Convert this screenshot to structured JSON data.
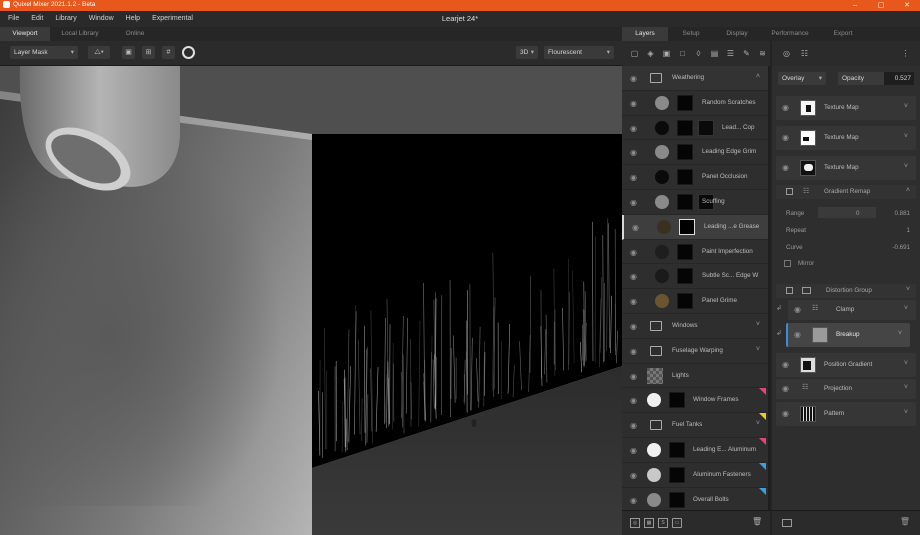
{
  "app": {
    "title": "Quixel Mixer 2021.1.2 - Beta",
    "document": "Learjet 24*"
  },
  "window_controls": {
    "minimize": "–",
    "maximize": "▢",
    "close": "✕"
  },
  "menu": [
    "File",
    "Edit",
    "Library",
    "Window",
    "Help",
    "Experimental"
  ],
  "viewport_tabs": [
    "Viewport",
    "Local Library",
    "Online"
  ],
  "viewport_toolbar": {
    "view_mode": "Layer Mask",
    "mode_3d": "3D",
    "lighting": "Flourescent"
  },
  "right_tabs": [
    "Layers",
    "Setup",
    "Display",
    "Performance",
    "Export"
  ],
  "layers": [
    {
      "name": "Weathering",
      "kind": "folder",
      "arrow": "˄"
    },
    {
      "name": "Random Scratches",
      "kind": "layer",
      "circle": "#8a8a8a"
    },
    {
      "name": "Lead... Cop",
      "kind": "layer2",
      "circle": "#0a0a0a"
    },
    {
      "name": "Leading Edge Grim",
      "kind": "layer",
      "circle": "#8a8a8a"
    },
    {
      "name": "Panel Occlusion",
      "kind": "layer",
      "circle": "#0a0a0a"
    },
    {
      "name": "Scuffing",
      "kind": "layer2",
      "circle": "#8a8a8a"
    },
    {
      "name": "Leading ...e Grease",
      "kind": "layer",
      "circle": "#3a3020",
      "selected": true
    },
    {
      "name": "Paint Imperfection",
      "kind": "layer",
      "circle": "#1e1e1e"
    },
    {
      "name": "Subtle Sc... Edge W",
      "kind": "layer",
      "circle": "#1a1a1a"
    },
    {
      "name": "Panel Grime",
      "kind": "layer",
      "circle": "#6b5530"
    },
    {
      "name": "Windows",
      "kind": "folder",
      "arrow": "˅"
    },
    {
      "name": "Fuselage Warping",
      "kind": "folder",
      "arrow": "˅"
    },
    {
      "name": "Lights",
      "kind": "checker"
    },
    {
      "name": "Window Frames",
      "kind": "layerg",
      "circle": "#f0f0f0",
      "tag": "#e0467a"
    },
    {
      "name": "Fuel Tanks",
      "kind": "folder",
      "arrow": "˅",
      "tag": "#e8d020"
    },
    {
      "name": "Leading E... Aluminum",
      "kind": "layerg",
      "circle": "#f0f0f0",
      "tag": "#e0467a"
    },
    {
      "name": "Aluminum Fasteners",
      "kind": "layerg",
      "circle": "#c8c8c8",
      "tag": "#3aa0e0"
    },
    {
      "name": "Overall Bolts",
      "kind": "layerg",
      "circle": "#8a8a8a",
      "tag": "#3aa0e0"
    }
  ],
  "properties": {
    "blend_mode": "Overlay",
    "opacity_label": "Opacity",
    "opacity_value": "0.527",
    "texture_maps": [
      "Texture Map",
      "Texture Map",
      "Texture Map"
    ],
    "gradient_remap": {
      "title": "Gradient Remap",
      "range_label": "Range",
      "range_min": "0",
      "range_max": "0.881",
      "repeat_label": "Repeat",
      "repeat_value": "1",
      "curve_label": "Curve",
      "curve_value": "-0.691",
      "mirror_label": "Mirror"
    },
    "distortion_group": "Distortion Group",
    "clamp": "Clamp",
    "breakup": "Breakup",
    "position_gradient": "Position Gradient",
    "projection": "Projection",
    "pattern": "Pattern"
  }
}
